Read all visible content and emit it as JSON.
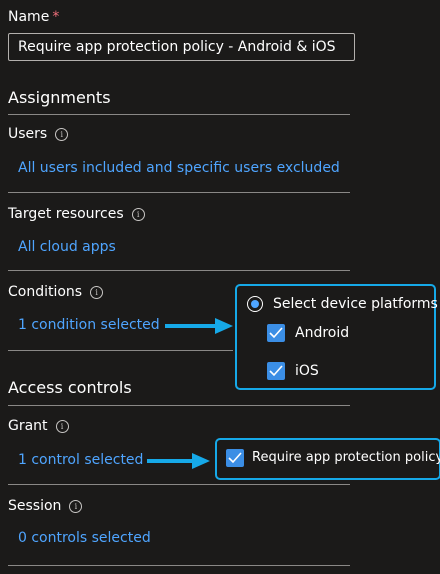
{
  "name_field": {
    "label": "Name",
    "required_mark": "*",
    "value": "Require app protection policy - Android & iOS"
  },
  "assignments": {
    "heading": "Assignments",
    "users": {
      "label": "Users",
      "value": "All users included and specific users excluded"
    },
    "target_resources": {
      "label": "Target resources",
      "value": "All cloud apps"
    },
    "conditions": {
      "label": "Conditions",
      "value": "1 condition selected"
    }
  },
  "conditions_callout": {
    "radio_label": "Select device platforms",
    "platforms": [
      {
        "label": "Android",
        "checked": true
      },
      {
        "label": "iOS",
        "checked": true
      }
    ]
  },
  "access_controls": {
    "heading": "Access controls",
    "grant": {
      "label": "Grant",
      "value": "1 control selected"
    },
    "session": {
      "label": "Session",
      "value": "0 controls selected"
    }
  },
  "grant_callout": {
    "label": "Require app protection policy",
    "checked": true
  },
  "colors": {
    "link": "#4fa5ff",
    "callout_border": "#16a9e8",
    "checkbox": "#3b8ee5",
    "required": "#f1707b"
  }
}
